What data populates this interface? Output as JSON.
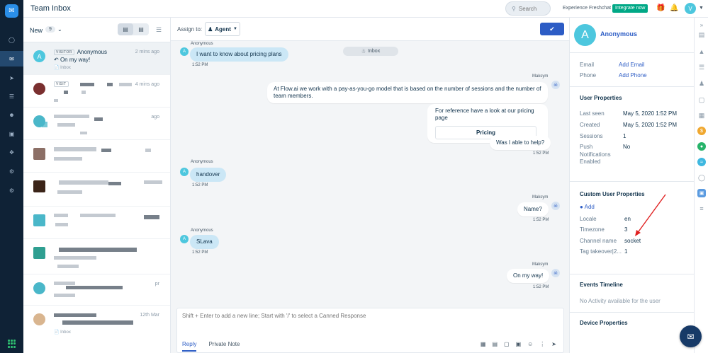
{
  "header": {
    "title": "Team Inbox",
    "search_placeholder": "Search",
    "experience_label": "Experience Freshchat",
    "integrate_label": "Integrate now",
    "user_initial": "V"
  },
  "list": {
    "filter_label": "New",
    "count": "9",
    "conversations": [
      {
        "name": "Anonymous",
        "badge": "VISITOR",
        "preview": "On my way!",
        "inbox": "Inbox",
        "time": "2 mins ago",
        "initial": "A"
      },
      {
        "badge": "VISIT",
        "time": "4 mins ago"
      },
      {
        "time": "ago"
      },
      {},
      {},
      {},
      {},
      {
        "time": "pr"
      },
      {
        "inbox": "Inbox",
        "time": "12th Mar"
      }
    ]
  },
  "chat": {
    "assign_label": "Assign to:",
    "agent_label": "Agent",
    "inbox_pill": "Inbox",
    "messages": [
      {
        "sender": "Anonymous",
        "text": "I want to know about pricing plans",
        "time": "1:52 PM"
      },
      {
        "sender": "Maksym",
        "text": "At Flow.ai we work with a pay-as-you-go model that is based on the number of sessions and the number of team members."
      },
      {
        "text": "For reference have a look at our pricing page",
        "button": "Pricing"
      },
      {
        "text": "Was I able to help?",
        "time": "1:52 PM"
      },
      {
        "sender": "Anonymous",
        "text": "handover",
        "time": "1:52 PM"
      },
      {
        "sender": "Maksym",
        "text": "Name?",
        "time": "1:52 PM"
      },
      {
        "sender": "Anonymous",
        "text": "SLava",
        "time": "1:52 PM"
      },
      {
        "sender": "Maksym",
        "text": "On my way!",
        "time": "1:52 PM"
      }
    ],
    "composer_placeholder": "Shift + Enter to add a new line; Start with '/' to select a Canned Response",
    "tab_reply": "Reply",
    "tab_note": "Private Note"
  },
  "profile": {
    "initial": "A",
    "name": "Anonymous",
    "email_label": "Email",
    "email_action": "Add Email",
    "phone_label": "Phone",
    "phone_action": "Add Phone",
    "user_props_title": "User Properties",
    "last_seen_label": "Last seen",
    "last_seen": "May 5, 2020 1:52 PM",
    "created_label": "Created",
    "created": "May 5, 2020 1:52 PM",
    "sessions_label": "Sessions",
    "sessions": "1",
    "push_label_1": "Push",
    "push_label_2": "Notifications",
    "push_label_3": "Enabled",
    "push": "No",
    "custom_title": "Custom User Properties",
    "add_label": "Add",
    "locale_label": "Locale",
    "locale": "en",
    "timezone_label": "Timezone",
    "timezone": "3",
    "channel_label": "Channel name",
    "channel": "socket",
    "tag_label": "Tag takeover|2...",
    "tag": "1",
    "events_title": "Events Timeline",
    "events_empty": "No Activity available for the user",
    "device_title": "Device Properties"
  },
  "colors": {
    "rail": "#0f2236",
    "accent": "#2c5cc5",
    "avatar": "#4dc7de",
    "user_bubble": "#cbe7f6",
    "integrate": "#00a886",
    "annotation_arrow": "#e02020"
  }
}
